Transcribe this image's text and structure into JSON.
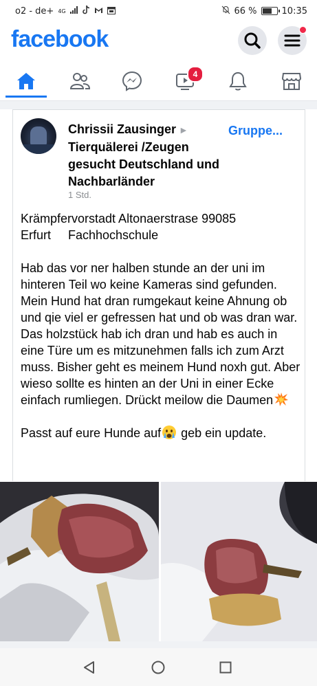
{
  "status_bar": {
    "carrier": "o2 - de+",
    "network": "4G",
    "battery_percent": "66 %",
    "battery_level": 0.66,
    "time": "10:35",
    "icons": [
      "signal-icon",
      "tiktok-icon",
      "gmail-icon",
      "calendar-icon",
      "mute-icon",
      "battery-icon"
    ]
  },
  "header": {
    "logo": "facebook",
    "search_icon": "search-icon",
    "menu_icon": "hamburger-menu-icon",
    "brand_color": "#1877f2"
  },
  "nav_tabs": [
    {
      "name": "home",
      "icon": "home-icon",
      "active": true
    },
    {
      "name": "friends",
      "icon": "friends-icon",
      "active": false
    },
    {
      "name": "messenger",
      "icon": "messenger-icon",
      "active": false
    },
    {
      "name": "watch",
      "icon": "video-icon",
      "active": false,
      "badge": "4"
    },
    {
      "name": "notifications",
      "icon": "bell-icon",
      "active": false
    },
    {
      "name": "marketplace",
      "icon": "marketplace-icon",
      "active": false
    }
  ],
  "post": {
    "author": "Chrissii Zausinger",
    "group_name": "Tierquälerei /Zeugen gesucht Deutschland und Nachbarländer",
    "group_link": "Gruppe...",
    "time": "1 Std.",
    "paragraph_1_line_1": "Krämpfervorstadt Altonaerstrase 99085",
    "paragraph_1_line_2": "Erfurt     Fachhochschule",
    "paragraph_2": "Hab das vor ner halben stunde an der uni im hinteren Teil wo keine Kameras sind gefunden. Mein Hund hat dran rumgekaut keine Ahnung ob und qie viel er gefressen hat und ob was dran war. Das holzstück hab ich dran und hab es auch in eine Türe um es mitzunehmen falls ich zum Arzt muss. Bisher geht es meinem Hund noxh gut. Aber wieso sollte es hinten an der Uni in einer Ecke einfach rumliegen. Drückt meilow die Daumen",
    "paragraph_3_before": "Passt auf eure Hunde auf",
    "paragraph_3_after": " geb ein update.",
    "emojis": [
      "collision-emoji",
      "crying-face-emoji"
    ]
  },
  "photos": [
    {
      "name": "photo-meat-wood-1"
    },
    {
      "name": "photo-meat-wood-2"
    }
  ],
  "android_nav": {
    "back": "back-triangle-icon",
    "home": "home-circle-icon",
    "recents": "recents-square-icon"
  }
}
